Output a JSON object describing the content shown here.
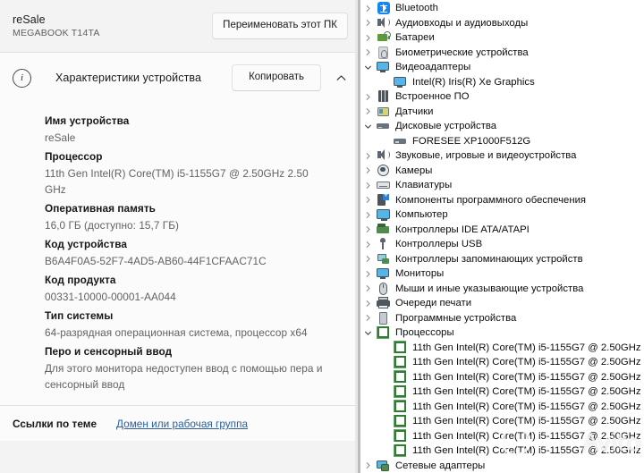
{
  "settings": {
    "pc_name": "reSale",
    "pc_model": "MEGABOOK T14TA",
    "rename_button": "Переименовать этот ПК",
    "section": {
      "title": "Характеристики устройства",
      "copy_button": "Копировать",
      "info_glyph": "i",
      "collapse_icon": "chevron-up-icon"
    },
    "specs": [
      {
        "key": "Имя устройства",
        "value": "reSale"
      },
      {
        "key": "Процессор",
        "value": "11th Gen Intel(R) Core(TM) i5-1155G7 @ 2.50GHz   2.50 GHz"
      },
      {
        "key": "Оперативная память",
        "value": "16,0 ГБ (доступно: 15,7 ГБ)"
      },
      {
        "key": "Код устройства",
        "value": "B6A4F0A5-52F7-4AD5-AB60-44F1CFAAC71C"
      },
      {
        "key": "Код продукта",
        "value": "00331-10000-00001-AA044"
      },
      {
        "key": "Тип системы",
        "value": "64-разрядная операционная система, процессор x64"
      },
      {
        "key": "Перо и сенсорный ввод",
        "value": "Для этого монитора недоступен ввод с помощью пера и сенсорный ввод"
      }
    ],
    "related": {
      "label": "Ссылки по теме",
      "link": "Домен или рабочая группа"
    }
  },
  "device_manager": {
    "nodes": [
      {
        "label": "Bluetooth",
        "level": 1,
        "state": "collapsed",
        "icon": "bluetooth-icon"
      },
      {
        "label": "Аудиовходы и аудиовыходы",
        "level": 1,
        "state": "collapsed",
        "icon": "speaker-icon"
      },
      {
        "label": "Батареи",
        "level": 1,
        "state": "collapsed",
        "icon": "battery-icon"
      },
      {
        "label": "Биометрические устройства",
        "level": 1,
        "state": "collapsed",
        "icon": "fingerprint-icon"
      },
      {
        "label": "Видеоадаптеры",
        "level": 1,
        "state": "expanded",
        "icon": "display-adapter-icon"
      },
      {
        "label": "Intel(R) Iris(R) Xe Graphics",
        "level": 2,
        "state": "leaf",
        "icon": "display-adapter-icon"
      },
      {
        "label": "Встроенное ПО",
        "level": 1,
        "state": "collapsed",
        "icon": "firmware-icon"
      },
      {
        "label": "Датчики",
        "level": 1,
        "state": "collapsed",
        "icon": "sensor-icon"
      },
      {
        "label": "Дисковые устройства",
        "level": 1,
        "state": "expanded",
        "icon": "disk-drive-icon"
      },
      {
        "label": "FORESEE XP1000F512G",
        "level": 2,
        "state": "leaf",
        "icon": "disk-drive-icon"
      },
      {
        "label": "Звуковые, игровые и видеоустройства",
        "level": 1,
        "state": "collapsed",
        "icon": "speaker-icon"
      },
      {
        "label": "Камеры",
        "level": 1,
        "state": "collapsed",
        "icon": "camera-icon"
      },
      {
        "label": "Клавиатуры",
        "level": 1,
        "state": "collapsed",
        "icon": "keyboard-icon"
      },
      {
        "label": "Компоненты программного обеспечения",
        "level": 1,
        "state": "collapsed",
        "icon": "software-component-icon"
      },
      {
        "label": "Компьютер",
        "level": 1,
        "state": "collapsed",
        "icon": "computer-icon"
      },
      {
        "label": "Контроллеры IDE ATA/ATAPI",
        "level": 1,
        "state": "collapsed",
        "icon": "ide-controller-icon"
      },
      {
        "label": "Контроллеры USB",
        "level": 1,
        "state": "collapsed",
        "icon": "usb-icon"
      },
      {
        "label": "Контроллеры запоминающих устройств",
        "level": 1,
        "state": "collapsed",
        "icon": "storage-controller-icon"
      },
      {
        "label": "Мониторы",
        "level": 1,
        "state": "collapsed",
        "icon": "monitor-icon"
      },
      {
        "label": "Мыши и иные указывающие устройства",
        "level": 1,
        "state": "collapsed",
        "icon": "mouse-icon"
      },
      {
        "label": "Очереди печати",
        "level": 1,
        "state": "collapsed",
        "icon": "printer-icon"
      },
      {
        "label": "Программные устройства",
        "level": 1,
        "state": "collapsed",
        "icon": "software-device-icon"
      },
      {
        "label": "Процессоры",
        "level": 1,
        "state": "expanded",
        "icon": "processor-icon"
      },
      {
        "label": "11th Gen Intel(R) Core(TM) i5-1155G7 @ 2.50GHz",
        "level": 2,
        "state": "leaf",
        "icon": "processor-icon"
      },
      {
        "label": "11th Gen Intel(R) Core(TM) i5-1155G7 @ 2.50GHz",
        "level": 2,
        "state": "leaf",
        "icon": "processor-icon"
      },
      {
        "label": "11th Gen Intel(R) Core(TM) i5-1155G7 @ 2.50GHz",
        "level": 2,
        "state": "leaf",
        "icon": "processor-icon"
      },
      {
        "label": "11th Gen Intel(R) Core(TM) i5-1155G7 @ 2.50GHz",
        "level": 2,
        "state": "leaf",
        "icon": "processor-icon"
      },
      {
        "label": "11th Gen Intel(R) Core(TM) i5-1155G7 @ 2.50GHz",
        "level": 2,
        "state": "leaf",
        "icon": "processor-icon"
      },
      {
        "label": "11th Gen Intel(R) Core(TM) i5-1155G7 @ 2.50GHz",
        "level": 2,
        "state": "leaf",
        "icon": "processor-icon"
      },
      {
        "label": "11th Gen Intel(R) Core(TM) i5-1155G7 @ 2.50GHz",
        "level": 2,
        "state": "leaf",
        "icon": "processor-icon"
      },
      {
        "label": "11th Gen Intel(R) Core(TM) i5-1155G7 @ 2.50GHz",
        "level": 2,
        "state": "leaf",
        "icon": "processor-icon"
      },
      {
        "label": "Сетевые адаптеры",
        "level": 1,
        "state": "collapsed",
        "icon": "network-adapter-icon"
      }
    ]
  },
  "watermark": {
    "text": "Avito"
  },
  "colors": {
    "settings_bg": "#f3f3f3",
    "card_bg": "#fbfbfb",
    "link": "#2c5f9e",
    "processor_green": "#2e7d32",
    "bluetooth_blue": "#1386f0"
  }
}
